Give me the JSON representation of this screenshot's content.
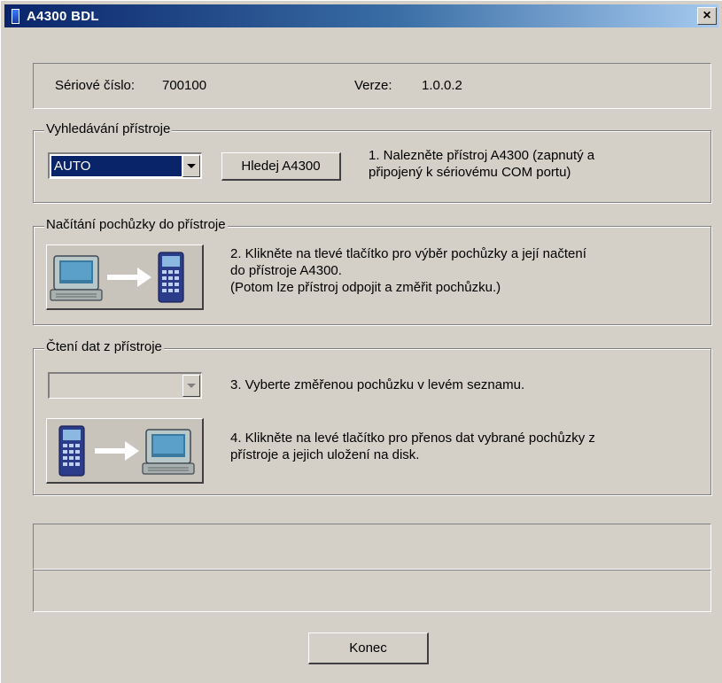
{
  "window": {
    "title": "A4300 BDL",
    "close_label": "×"
  },
  "info": {
    "serial_label": "Sériové číslo:",
    "serial_value": "700100",
    "version_label": "Verze:",
    "version_value": "1.0.0.2"
  },
  "search_group": {
    "title": "Vyhledávání přístroje",
    "port_value": "AUTO",
    "search_button": "Hledej A4300",
    "instruction_line1": "1. Nalezněte přístroj A4300 (zapnutý a",
    "instruction_line2": "připojený k sériovému COM portu)"
  },
  "load_group": {
    "title": "Načítání pochůzky do přístroje",
    "instruction_line1": "2. Klikněte na tlevé tlačítko pro výběr pochůzky a její načtení",
    "instruction_line2": "do přístroje A4300.",
    "instruction_line3": "(Potom lze přístroj odpojit a změřit pochůzku.)"
  },
  "read_group": {
    "title": "Čtení dat z přístroje",
    "route_value": "",
    "step3": "3. Vyberte změřenou pochůzku v levém seznamu.",
    "step4_line1": "4. Klikněte na levé tlačítko pro přenos dat vybrané pochůzky z",
    "step4_line2": "přístroje a jejich uložení na disk."
  },
  "status": {
    "line1": "",
    "line2": ""
  },
  "footer": {
    "close_button": "Konec"
  },
  "icons": {
    "upload": "computer-to-device-icon",
    "download": "device-to-computer-icon"
  }
}
